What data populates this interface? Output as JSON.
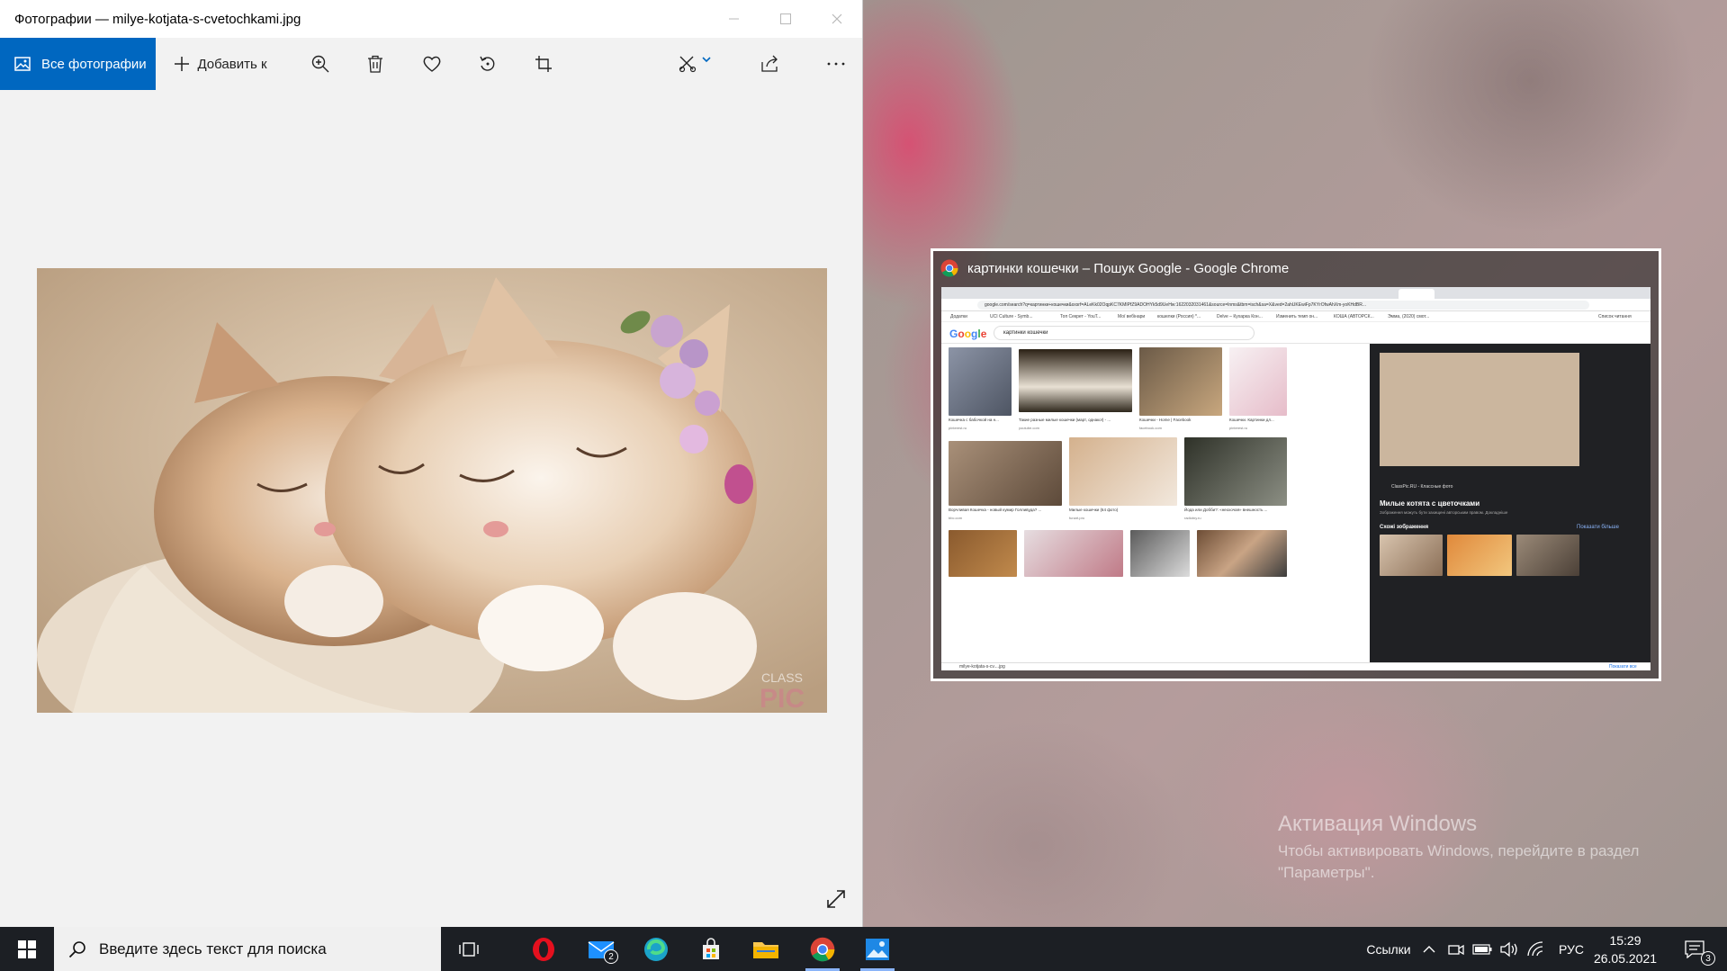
{
  "photos_window": {
    "title": "Фотографии — milye-kotjata-s-cvetochkami.jpg",
    "toolbar": {
      "all_photos_label": "Все фотографии",
      "add_to_label": "Добавить к"
    },
    "photo": {
      "watermark_top": "CLASS",
      "watermark_bottom": "PIC"
    }
  },
  "chrome_preview": {
    "title": "картинки кошечки – Пошук Google - Google Chrome",
    "url": "google.com/search?q=картинки+кошечки&sxsrf=ALeKk02OqpKC7KMIPfZ9ADOHYk5d9UeHw:1622032031461&source=lnms&tbm=isch&sa=X&ved=2ahUKEwiFp7KYrOfwAhXm-yoKHdBR...",
    "bookmarks": [
      "Додатки",
      "UCI Culture - Symb...",
      "Топ Секрет - YouT...",
      "Мої вебінари",
      "кошелки (Россия) *...",
      "Delve – Кухарка Кон...",
      "Изменить темп он...",
      "КОША (АВТОРСК...",
      "Эмма, (2020) смот...",
      "Список читання"
    ],
    "google_logo": "Google",
    "search_query": "картинки кошечки",
    "results": [
      {
        "caption": "Кошечка с бабочкой на н...",
        "source": "pinterest.ru"
      },
      {
        "caption": "Такие разные милые кошечки (март, однако!) - ...",
        "source": "youtube.com"
      },
      {
        "caption": "Кошечки - Home | Facebook",
        "source": "facebook.com"
      },
      {
        "caption": "Кошечки. Картинки дл...",
        "source": "pinterest.ru"
      },
      {
        "caption": "Ворчливая Кошечка - новый кумир Голливуда? ...",
        "source": "bbc.com"
      },
      {
        "caption": "Милые кошечки (64 фото)",
        "source": "funart.pro"
      },
      {
        "caption": "Йода или Добби?: «неохочая» внешность ...",
        "source": "radiotny.ru"
      }
    ],
    "panel": {
      "source": "ClassPic.RU - Классные фото",
      "title": "Милые котята с цветочками",
      "subtitle": "Зображення можуть бути захищені авторським правом. Докладніше",
      "similar_label": "Схожі зображення",
      "show_more": "Показати більше"
    },
    "download_file": "milye-kotjata-s-cv....jpg",
    "show_all": "Показати все"
  },
  "activation": {
    "title": "Активация Windows",
    "text": "Чтобы активировать Windows, перейдите в раздел \"Параметры\"."
  },
  "taskbar": {
    "search_placeholder": "Введите здесь текст для поиска",
    "mail_badge": "2",
    "links_label": "Ссылки",
    "language": "РУС",
    "time": "15:29",
    "date": "26.05.2021",
    "notification_count": "3"
  },
  "colors": {
    "accent": "#0067c0",
    "taskbar": "#1c1f24"
  }
}
